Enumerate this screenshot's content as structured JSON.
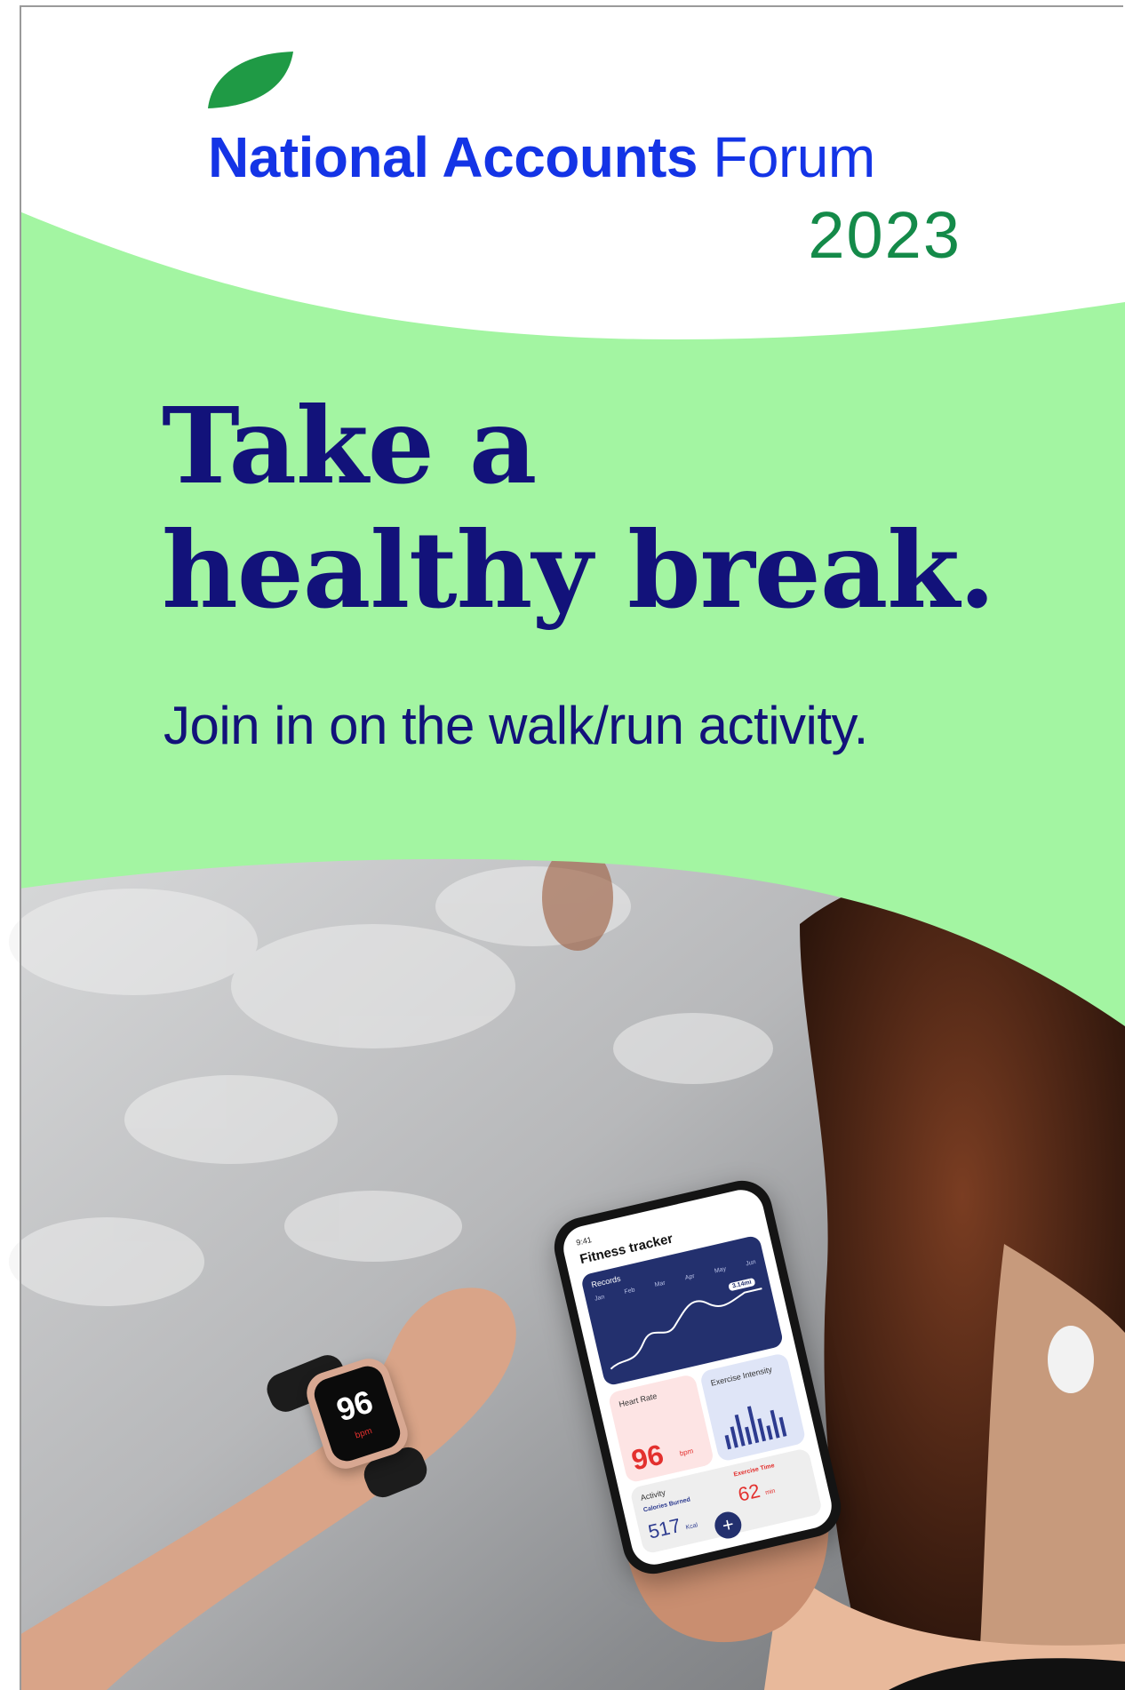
{
  "brand": {
    "name_bold": "National Accounts",
    "name_light": "Forum",
    "year": "2023",
    "leaf_icon": "leaf-icon"
  },
  "headline": {
    "line1": "Take a",
    "line2": "healthy break."
  },
  "subheadline": "Join in on the walk/run activity.",
  "photo": {
    "watch": {
      "value": "96",
      "unit": "bpm"
    },
    "phone": {
      "time": "9:41",
      "title": "Fitness tracker",
      "records_label": "Records",
      "months": [
        "Jan",
        "Feb",
        "Mar",
        "Apr",
        "May",
        "Jun"
      ],
      "records_badge": "3.14mi",
      "heart_label": "Heart Rate",
      "heart_value": "96",
      "heart_unit": "bpm",
      "intensity_label": "Exercise Intensity",
      "activity_label": "Activity",
      "calories_label": "Calories Burned",
      "calories_value": "517",
      "calories_unit": "Kcal",
      "exercise_label": "Exercise Time",
      "exercise_value": "62",
      "exercise_unit": "min",
      "add_button": "+"
    }
  },
  "colors": {
    "brand_blue": "#1434e6",
    "brand_green": "#148a49",
    "band_green": "#a3f5a2",
    "headline_navy": "#12127a",
    "leaf_green": "#1f9a45"
  }
}
